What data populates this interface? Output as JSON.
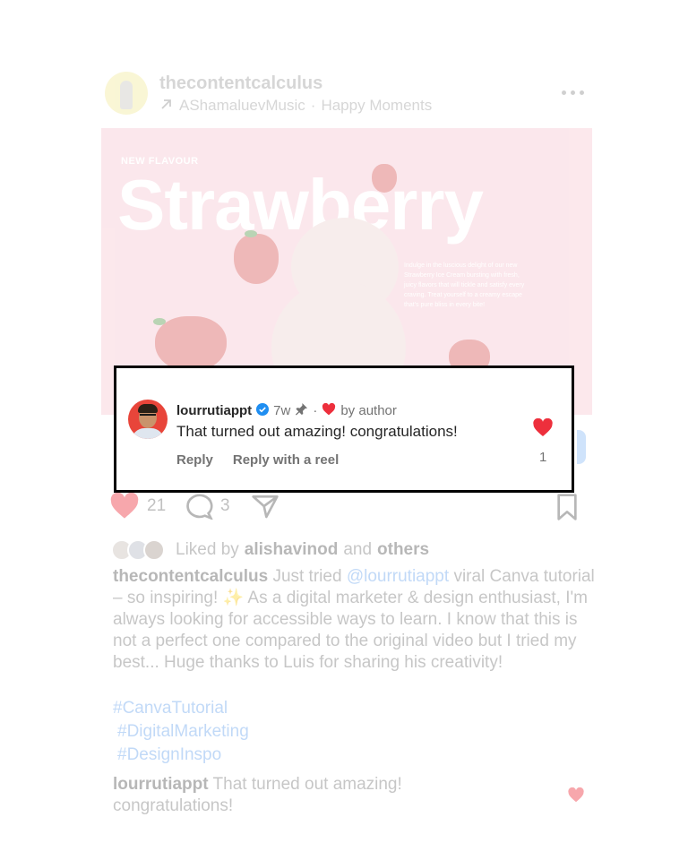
{
  "post": {
    "username": "thecontentcalculus",
    "audio_artist": "AShamaluevMusic",
    "audio_separator": "·",
    "audio_title": "Happy Moments",
    "image": {
      "eyebrow": "NEW FLAVOUR",
      "title": "Strawberry",
      "description": "Indulge in the luscious delight of our new Strawberry Ice Cream bursting with fresh, juicy flavors that will tickle and satisfy every craving. Treat yourself to a creamy escape that's pure bliss in every bite!"
    },
    "like_count": "21",
    "comment_count": "3",
    "liked_by_prefix": "Liked by",
    "liked_by_user": "alishavinod",
    "liked_by_and": "and",
    "liked_by_others": "others",
    "caption_user": "thecontentcalculus",
    "caption_pre": "Just tried",
    "caption_mention": "@lourrutiappt",
    "caption_rest": "viral Canva tutorial – so inspiring! ✨ As a digital marketer & design enthusiast, I'm always looking for accessible ways to learn. I know that this is not a perfect one compared to the original video but I tried my best... Huge thanks to Luis for sharing his creativity!",
    "hashtags": [
      "#CanvaTutorial",
      "#DigitalMarketing",
      "#DesignInspo"
    ],
    "bottom_comment_user": "lourrutiappt",
    "bottom_comment_text": "That turned out amazing! congratulations!"
  },
  "comment_card": {
    "username": "lourrutiappt",
    "time": "7w",
    "separator": "·",
    "liked_by_author": "by author",
    "text": "That turned out amazing! congratulations!",
    "reply_label": "Reply",
    "reply_reel_label": "Reply with a reel",
    "like_count": "1"
  },
  "colors": {
    "like_red": "#ed2f3c",
    "verified_blue": "#1f8ef1",
    "mention_blue": "#6ea7ee",
    "card_border": "#000000",
    "post_image_bg": "#f7c8d2"
  },
  "icons": [
    "more-icon",
    "heart-icon",
    "comment-icon",
    "share-icon",
    "bookmark-icon",
    "verified-icon",
    "pin-icon",
    "reel-arrow-icon"
  ]
}
